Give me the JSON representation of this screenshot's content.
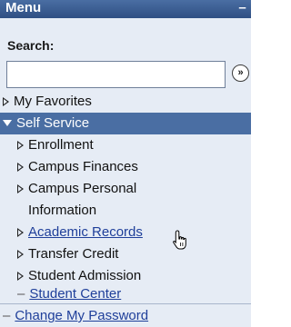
{
  "menu": {
    "title": "Menu",
    "collapse_label": "–"
  },
  "search": {
    "label": "Search:",
    "value": "",
    "go_label": "»"
  },
  "nav": {
    "my_favorites": "My Favorites",
    "self_service": "Self Service",
    "children": {
      "enrollment": "Enrollment",
      "campus_finances": "Campus Finances",
      "campus_personal_line1": "Campus Personal",
      "campus_personal_line2": "Information",
      "academic_records": "Academic Records",
      "transfer_credit": "Transfer Credit",
      "student_admission": "Student Admission",
      "student_center": "Student Center"
    },
    "change_my_password": "Change My Password"
  },
  "icons": {
    "collapse": "minus-icon",
    "expand_arrow": "triangle-right-outline-icon",
    "expanded_arrow": "triangle-down-icon",
    "leaf_dash": "dash-icon",
    "search_go": "double-chevron-right-icon",
    "cursor": "hand-pointer-icon"
  }
}
